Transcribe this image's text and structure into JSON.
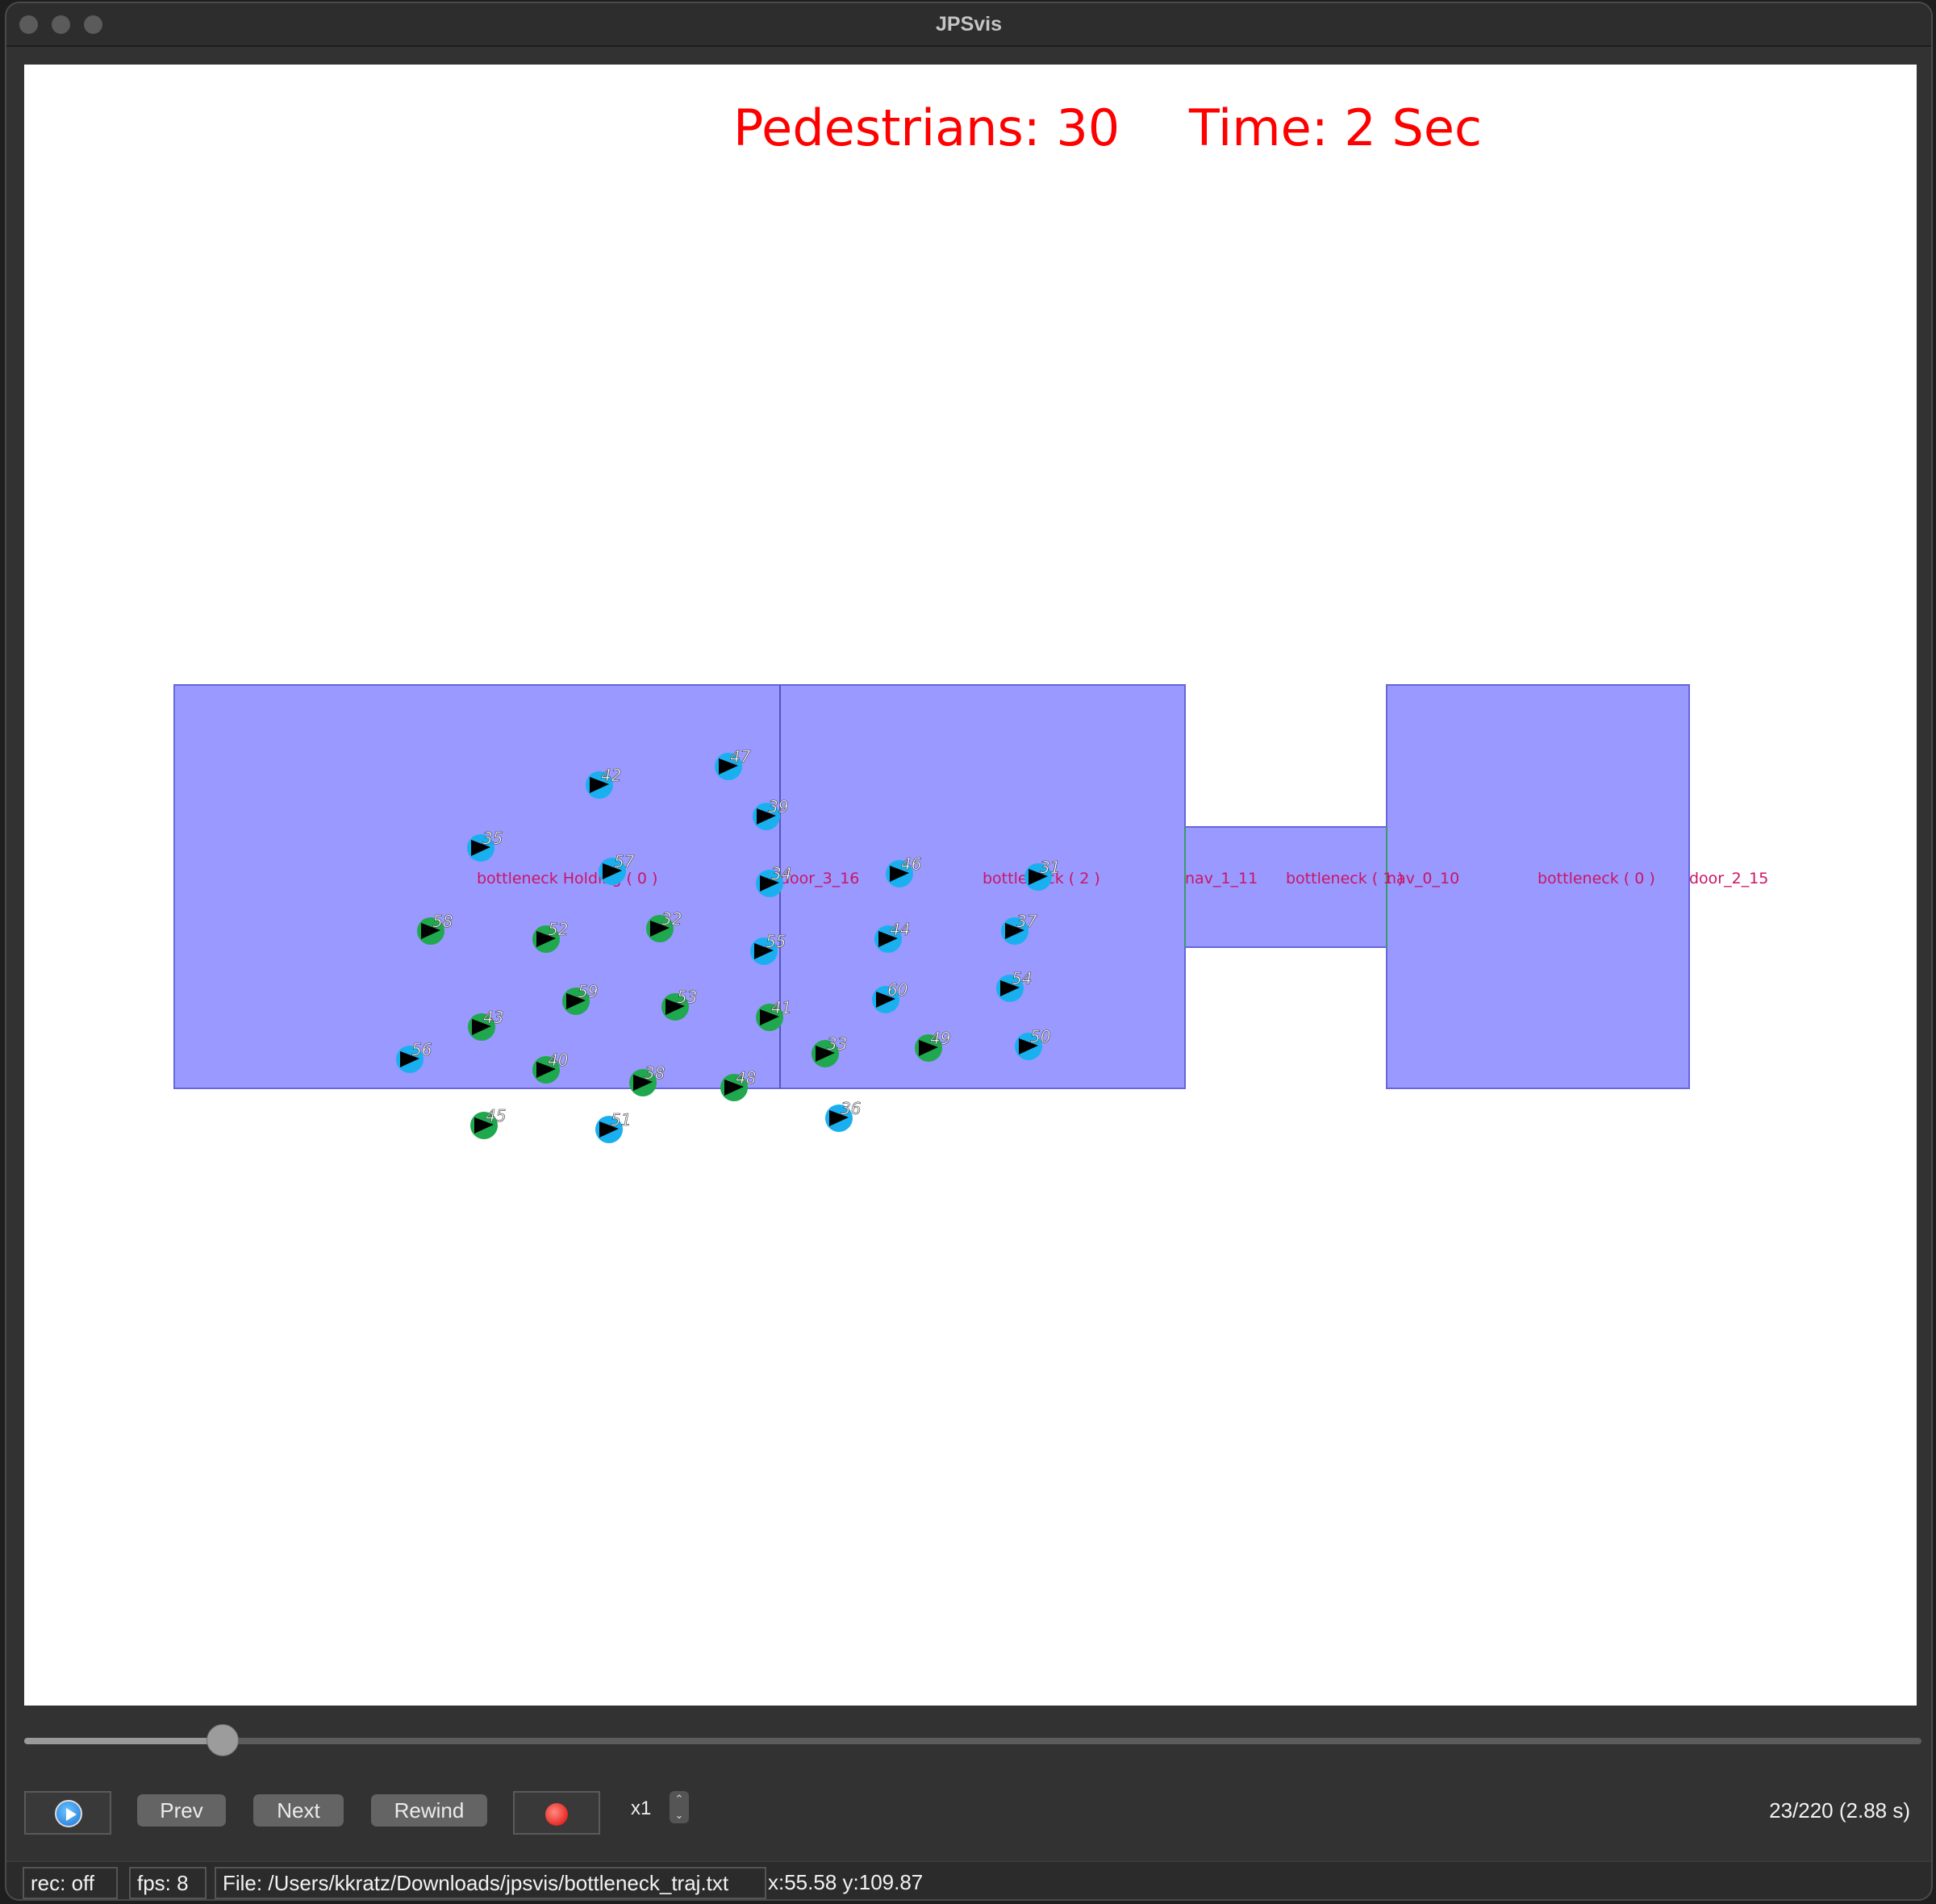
{
  "window": {
    "title": "JPSvis"
  },
  "overlay": {
    "pedestrians_label": "Pedestrians: 30",
    "time_label": "Time: 2 Sec",
    "color": "#ff0000"
  },
  "geometry": {
    "room_fill": "#9999ff",
    "room_stroke": "#5555cc",
    "labels": [
      {
        "id": "bottleneck-holding",
        "text": "bottleneck Holding ( 0 )"
      },
      {
        "id": "door-3-16",
        "text": "door_3_16"
      },
      {
        "id": "bottleneck-2",
        "text": "bottleneck ( 2 )"
      },
      {
        "id": "nav-1-11",
        "text": "nav_1_11"
      },
      {
        "id": "bottleneck-1",
        "text": "bottleneck ( 1 )"
      },
      {
        "id": "nav-0-10",
        "text": "nav_0_10"
      },
      {
        "id": "bottleneck-0",
        "text": "bottleneck ( 0 )"
      },
      {
        "id": "door-2-15",
        "text": "door_2_15"
      }
    ]
  },
  "pedestrians": [
    {
      "id": "42",
      "color": "cyan"
    },
    {
      "id": "47",
      "color": "cyan"
    },
    {
      "id": "39",
      "color": "cyan"
    },
    {
      "id": "35",
      "color": "cyan"
    },
    {
      "id": "57",
      "color": "cyan"
    },
    {
      "id": "34",
      "color": "cyan"
    },
    {
      "id": "46",
      "color": "cyan"
    },
    {
      "id": "31",
      "color": "cyan"
    },
    {
      "id": "58",
      "color": "green"
    },
    {
      "id": "52",
      "color": "green"
    },
    {
      "id": "32",
      "color": "green"
    },
    {
      "id": "55",
      "color": "cyan"
    },
    {
      "id": "44",
      "color": "cyan"
    },
    {
      "id": "37",
      "color": "cyan"
    },
    {
      "id": "59",
      "color": "green"
    },
    {
      "id": "53",
      "color": "green"
    },
    {
      "id": "41",
      "color": "green"
    },
    {
      "id": "60",
      "color": "cyan"
    },
    {
      "id": "54",
      "color": "cyan"
    },
    {
      "id": "43",
      "color": "green"
    },
    {
      "id": "56",
      "color": "cyan"
    },
    {
      "id": "40",
      "color": "green"
    },
    {
      "id": "38",
      "color": "green"
    },
    {
      "id": "48",
      "color": "green"
    },
    {
      "id": "33",
      "color": "green"
    },
    {
      "id": "49",
      "color": "green"
    },
    {
      "id": "50",
      "color": "cyan"
    },
    {
      "id": "36",
      "color": "cyan"
    },
    {
      "id": "45",
      "color": "green"
    },
    {
      "id": "51",
      "color": "cyan"
    }
  ],
  "colors": {
    "cyan": "#1ab0f0",
    "green": "#1fa84e"
  },
  "controls": {
    "prev_label": "Prev",
    "next_label": "Next",
    "rewind_label": "Rewind",
    "speed_value": "x1",
    "playback_fraction": 0.1045,
    "frame_info": "23/220 (2.88 s)"
  },
  "statusbar": {
    "rec": "rec: off",
    "fps": "fps: 8",
    "file": "File: /Users/kkratz/Downloads/jpsvis/bottleneck_traj.txt",
    "coords": "x:55.58 y:109.87"
  }
}
